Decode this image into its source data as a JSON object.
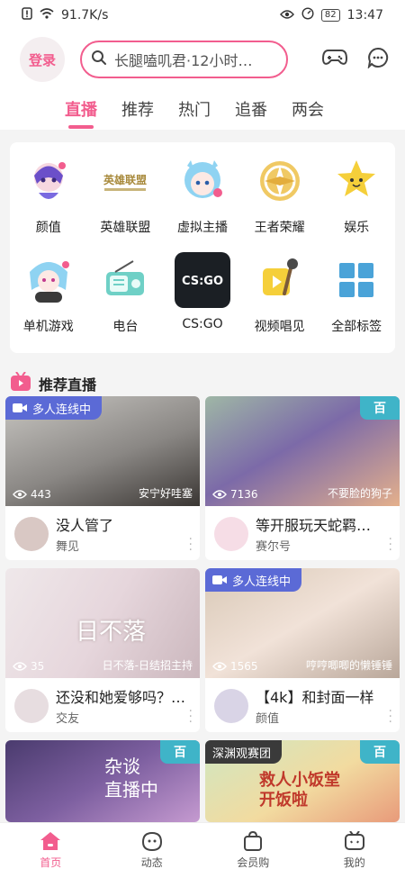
{
  "status_bar": {
    "speed": "91.7K/s",
    "battery": "82",
    "time": "13:47"
  },
  "header": {
    "login_label": "登录",
    "search_text": "长腿嗑叽君·12小时…"
  },
  "tabs": [
    {
      "label": "直播",
      "active": true
    },
    {
      "label": "推荐",
      "active": false
    },
    {
      "label": "热门",
      "active": false
    },
    {
      "label": "追番",
      "active": false
    },
    {
      "label": "两会",
      "active": false
    }
  ],
  "categories": [
    {
      "label": "颜值"
    },
    {
      "label": "英雄联盟"
    },
    {
      "label": "虚拟主播"
    },
    {
      "label": "王者荣耀"
    },
    {
      "label": "娱乐"
    },
    {
      "label": "单机游戏"
    },
    {
      "label": "电台"
    },
    {
      "label": "CS:GO"
    },
    {
      "label": "视频唱见"
    },
    {
      "label": "全部标签"
    }
  ],
  "category_logo_text": {
    "lol": "英雄联盟",
    "csgo": "CS:GO"
  },
  "section": {
    "title": "推荐直播"
  },
  "cards": [
    {
      "badge": "多人连线中",
      "viewers": "443",
      "streamer": "安宁好哇塞",
      "title": "没人管了",
      "area": "舞见"
    },
    {
      "corner": "百",
      "viewers": "7136",
      "streamer": "不要脸的狗子",
      "title": "等开服玩天蛇羁…",
      "area": "赛尔号"
    },
    {
      "viewers": "35",
      "streamer": "日不落-日结招主持",
      "overlay_text": "日不落",
      "title": "还没和她爱够吗？…",
      "area": "交友"
    },
    {
      "badge": "多人连线中",
      "viewers": "1565",
      "streamer": "哼哼唧唧的懒锤锤",
      "title": "【4k】和封面一样",
      "area": "颜值"
    },
    {
      "corner": "百",
      "overlay_text": "杂谈\n直播中"
    },
    {
      "badge": "深渊观赛团",
      "corner": "百",
      "overlay_text": "救人小饭堂\n开饭啦"
    }
  ],
  "bottom_nav": [
    {
      "label": "首页",
      "active": true
    },
    {
      "label": "动态",
      "active": false
    },
    {
      "label": "会员购",
      "active": false
    },
    {
      "label": "我的",
      "active": false
    }
  ],
  "colors": {
    "accent": "#f25d8e",
    "badge": "#5b6ad6",
    "corner_tag": "#3fb4c8"
  }
}
